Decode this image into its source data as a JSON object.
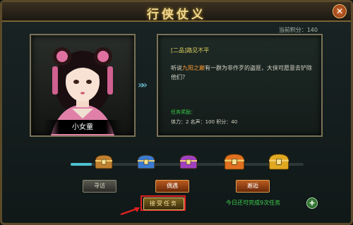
{
  "window": {
    "title": "行侠仗义",
    "close_icon": "✕"
  },
  "score": {
    "text": "当前积分：140"
  },
  "npc": {
    "name": "小女童"
  },
  "quest": {
    "title": "[二品]路见不平",
    "desc_prefix": "听说",
    "desc_highlight": "九阳之巅",
    "desc_suffix": "有一群为非作歹的盗匪，大侠可愿意去铲除他们？",
    "reward_label": "任务奖励：",
    "reward_values": "体力：2  名声：100  积分：40"
  },
  "progress": {
    "filled_fraction": 0.09
  },
  "chests": [
    {
      "name": "chest-bronze",
      "color": "#c08030"
    },
    {
      "name": "chest-blue",
      "color": "#3a7ad0"
    },
    {
      "name": "chest-purple",
      "color": "#a040c0"
    },
    {
      "name": "chest-orange",
      "color": "#e07020"
    },
    {
      "name": "chest-gold",
      "color": "#e0a820"
    }
  ],
  "stages": [
    {
      "label": "寻访",
      "active": false
    },
    {
      "label": "偶遇",
      "active": true
    },
    {
      "label": "邂逅",
      "active": true
    }
  ],
  "accept": {
    "label": "接受任务"
  },
  "footer": {
    "remaining": "今日还可完成9次任务",
    "plus_icon": "+"
  },
  "colors": {
    "accent": "#f0d890",
    "highlight": "#ff9a30",
    "green": "#40d050"
  }
}
